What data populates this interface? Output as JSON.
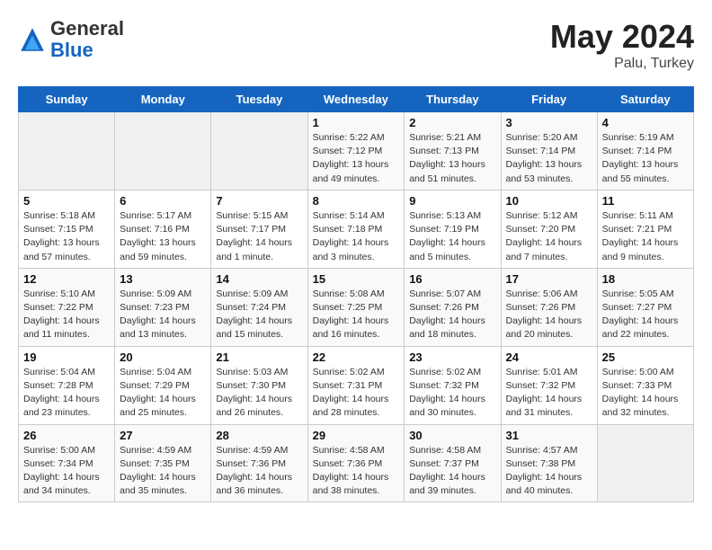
{
  "header": {
    "logo_general": "General",
    "logo_blue": "Blue",
    "month": "May 2024",
    "location": "Palu, Turkey"
  },
  "weekdays": [
    "Sunday",
    "Monday",
    "Tuesday",
    "Wednesday",
    "Thursday",
    "Friday",
    "Saturday"
  ],
  "weeks": [
    [
      {
        "day": "",
        "sunrise": "",
        "sunset": "",
        "daylight": ""
      },
      {
        "day": "",
        "sunrise": "",
        "sunset": "",
        "daylight": ""
      },
      {
        "day": "",
        "sunrise": "",
        "sunset": "",
        "daylight": ""
      },
      {
        "day": "1",
        "sunrise": "Sunrise: 5:22 AM",
        "sunset": "Sunset: 7:12 PM",
        "daylight": "Daylight: 13 hours and 49 minutes."
      },
      {
        "day": "2",
        "sunrise": "Sunrise: 5:21 AM",
        "sunset": "Sunset: 7:13 PM",
        "daylight": "Daylight: 13 hours and 51 minutes."
      },
      {
        "day": "3",
        "sunrise": "Sunrise: 5:20 AM",
        "sunset": "Sunset: 7:14 PM",
        "daylight": "Daylight: 13 hours and 53 minutes."
      },
      {
        "day": "4",
        "sunrise": "Sunrise: 5:19 AM",
        "sunset": "Sunset: 7:14 PM",
        "daylight": "Daylight: 13 hours and 55 minutes."
      }
    ],
    [
      {
        "day": "5",
        "sunrise": "Sunrise: 5:18 AM",
        "sunset": "Sunset: 7:15 PM",
        "daylight": "Daylight: 13 hours and 57 minutes."
      },
      {
        "day": "6",
        "sunrise": "Sunrise: 5:17 AM",
        "sunset": "Sunset: 7:16 PM",
        "daylight": "Daylight: 13 hours and 59 minutes."
      },
      {
        "day": "7",
        "sunrise": "Sunrise: 5:15 AM",
        "sunset": "Sunset: 7:17 PM",
        "daylight": "Daylight: 14 hours and 1 minute."
      },
      {
        "day": "8",
        "sunrise": "Sunrise: 5:14 AM",
        "sunset": "Sunset: 7:18 PM",
        "daylight": "Daylight: 14 hours and 3 minutes."
      },
      {
        "day": "9",
        "sunrise": "Sunrise: 5:13 AM",
        "sunset": "Sunset: 7:19 PM",
        "daylight": "Daylight: 14 hours and 5 minutes."
      },
      {
        "day": "10",
        "sunrise": "Sunrise: 5:12 AM",
        "sunset": "Sunset: 7:20 PM",
        "daylight": "Daylight: 14 hours and 7 minutes."
      },
      {
        "day": "11",
        "sunrise": "Sunrise: 5:11 AM",
        "sunset": "Sunset: 7:21 PM",
        "daylight": "Daylight: 14 hours and 9 minutes."
      }
    ],
    [
      {
        "day": "12",
        "sunrise": "Sunrise: 5:10 AM",
        "sunset": "Sunset: 7:22 PM",
        "daylight": "Daylight: 14 hours and 11 minutes."
      },
      {
        "day": "13",
        "sunrise": "Sunrise: 5:09 AM",
        "sunset": "Sunset: 7:23 PM",
        "daylight": "Daylight: 14 hours and 13 minutes."
      },
      {
        "day": "14",
        "sunrise": "Sunrise: 5:09 AM",
        "sunset": "Sunset: 7:24 PM",
        "daylight": "Daylight: 14 hours and 15 minutes."
      },
      {
        "day": "15",
        "sunrise": "Sunrise: 5:08 AM",
        "sunset": "Sunset: 7:25 PM",
        "daylight": "Daylight: 14 hours and 16 minutes."
      },
      {
        "day": "16",
        "sunrise": "Sunrise: 5:07 AM",
        "sunset": "Sunset: 7:26 PM",
        "daylight": "Daylight: 14 hours and 18 minutes."
      },
      {
        "day": "17",
        "sunrise": "Sunrise: 5:06 AM",
        "sunset": "Sunset: 7:26 PM",
        "daylight": "Daylight: 14 hours and 20 minutes."
      },
      {
        "day": "18",
        "sunrise": "Sunrise: 5:05 AM",
        "sunset": "Sunset: 7:27 PM",
        "daylight": "Daylight: 14 hours and 22 minutes."
      }
    ],
    [
      {
        "day": "19",
        "sunrise": "Sunrise: 5:04 AM",
        "sunset": "Sunset: 7:28 PM",
        "daylight": "Daylight: 14 hours and 23 minutes."
      },
      {
        "day": "20",
        "sunrise": "Sunrise: 5:04 AM",
        "sunset": "Sunset: 7:29 PM",
        "daylight": "Daylight: 14 hours and 25 minutes."
      },
      {
        "day": "21",
        "sunrise": "Sunrise: 5:03 AM",
        "sunset": "Sunset: 7:30 PM",
        "daylight": "Daylight: 14 hours and 26 minutes."
      },
      {
        "day": "22",
        "sunrise": "Sunrise: 5:02 AM",
        "sunset": "Sunset: 7:31 PM",
        "daylight": "Daylight: 14 hours and 28 minutes."
      },
      {
        "day": "23",
        "sunrise": "Sunrise: 5:02 AM",
        "sunset": "Sunset: 7:32 PM",
        "daylight": "Daylight: 14 hours and 30 minutes."
      },
      {
        "day": "24",
        "sunrise": "Sunrise: 5:01 AM",
        "sunset": "Sunset: 7:32 PM",
        "daylight": "Daylight: 14 hours and 31 minutes."
      },
      {
        "day": "25",
        "sunrise": "Sunrise: 5:00 AM",
        "sunset": "Sunset: 7:33 PM",
        "daylight": "Daylight: 14 hours and 32 minutes."
      }
    ],
    [
      {
        "day": "26",
        "sunrise": "Sunrise: 5:00 AM",
        "sunset": "Sunset: 7:34 PM",
        "daylight": "Daylight: 14 hours and 34 minutes."
      },
      {
        "day": "27",
        "sunrise": "Sunrise: 4:59 AM",
        "sunset": "Sunset: 7:35 PM",
        "daylight": "Daylight: 14 hours and 35 minutes."
      },
      {
        "day": "28",
        "sunrise": "Sunrise: 4:59 AM",
        "sunset": "Sunset: 7:36 PM",
        "daylight": "Daylight: 14 hours and 36 minutes."
      },
      {
        "day": "29",
        "sunrise": "Sunrise: 4:58 AM",
        "sunset": "Sunset: 7:36 PM",
        "daylight": "Daylight: 14 hours and 38 minutes."
      },
      {
        "day": "30",
        "sunrise": "Sunrise: 4:58 AM",
        "sunset": "Sunset: 7:37 PM",
        "daylight": "Daylight: 14 hours and 39 minutes."
      },
      {
        "day": "31",
        "sunrise": "Sunrise: 4:57 AM",
        "sunset": "Sunset: 7:38 PM",
        "daylight": "Daylight: 14 hours and 40 minutes."
      },
      {
        "day": "",
        "sunrise": "",
        "sunset": "",
        "daylight": ""
      }
    ]
  ]
}
